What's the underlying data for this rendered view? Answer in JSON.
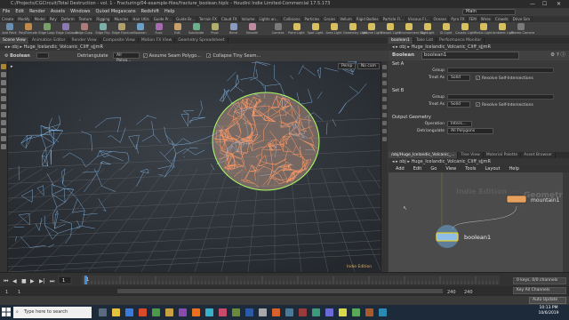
{
  "window": {
    "title": "C:/Projects/CGCircuit/Total Destruction - vol. 1 - Fracturing/04-example-files/fracture_boolean.hiplc - Houdini Indie Limited-Commercial 17.5.173",
    "minimize_glyph": "—",
    "maximize_glyph": "☐",
    "close_glyph": "✕"
  },
  "menubar": {
    "items": [
      "File",
      "Edit",
      "Render",
      "Assets",
      "Windows",
      "Quixel Megascans",
      "Redshift",
      "Help"
    ],
    "desktop": "Main"
  },
  "shelf": {
    "tabs": [
      "Create",
      "Modify",
      "Model",
      "Poly",
      "Deform",
      "Texture",
      "Rigging",
      "Muscles",
      "Hair Utils",
      "Guide Pr...",
      "Guide Br...",
      "Terrain FX",
      "Cloud FX",
      "Volume"
    ],
    "right_tabs": [
      "Lights an...",
      "Collisions",
      "Particles",
      "Grains",
      "Vellum",
      "Rigid Bodies",
      "Particle Fl...",
      "Viscous Fl...",
      "Oceans",
      "Pyro FX",
      "FEM",
      "Wires",
      "Crowds",
      "Drive Sim"
    ],
    "tools": [
      "Add Point",
      "PolyExtrude",
      "Edge Loop",
      "Edge Collapse",
      "Edge Cusp",
      "Edge Flip",
      "Edge Fracture",
      "Boolean",
      "Fuse",
      "Edit",
      "Subdivide",
      "Pivot",
      "Bend",
      "Smooth"
    ],
    "right_tools": [
      "Camera",
      "Point Light",
      "Spot Light",
      "Area Light",
      "Geometry Light",
      "Volume Light",
      "Distant Light",
      "Environment Light",
      "Sky Light",
      "GI Light",
      "Caustic Light",
      "Portal Light",
      "Ambient Light",
      "Stereo Camera"
    ]
  },
  "viewport_pane": {
    "tabs": [
      "Scene View",
      "Animation Editor",
      "Render View",
      "Composite View",
      "Motion FX View",
      "Geometry Spreadsheet"
    ],
    "path": [
      "obj",
      "Huge_Icelandic_Volcanic_Cliff_sjjmR"
    ],
    "node_label": "Boolean",
    "group_field": "",
    "operation_label": "Detriangulate",
    "operation_value": "All Polyg...",
    "toggles": [
      {
        "label": "Assume Seam Polygo...",
        "on": true
      },
      {
        "label": "Collapse Tiny Seam...",
        "on": true
      }
    ],
    "view_label": "Persp",
    "camera_label": "No cam",
    "watermark": "Indie Edition"
  },
  "parameters_pane": {
    "tabs": [
      "boolean1",
      "Take List",
      "Performance Monitor"
    ],
    "path": [
      "obj",
      "Huge_Icelandic_Volcanic_Cliff_sjjmR"
    ],
    "node_type": "Boolean",
    "node_name": "boolean1",
    "set_a": {
      "header": "Set A",
      "group_label": "Group",
      "group_value": "",
      "treat_as_label": "Treat As",
      "treat_as_value": "Solid",
      "resolve_label": "Resolve Self-Intersections",
      "resolve_on": true
    },
    "set_b": {
      "header": "Set B",
      "group_label": "Group",
      "group_value": "",
      "treat_as_label": "Treat As",
      "treat_as_value": "Solid",
      "resolve_label": "Resolve Self-Intersections",
      "resolve_on": true
    },
    "output": {
      "header": "Output Geometry",
      "operation_label": "Operation",
      "operation_value": "Inters...",
      "detriangulate_label": "Detriangulate",
      "detriangulate_value": "All Polygons"
    }
  },
  "network_pane": {
    "tabs": [
      "/obj/Huge_Icelandic_Volcanic_...",
      "Tree View",
      "Material Palette",
      "Asset Browser"
    ],
    "path": [
      "obj",
      "Huge_Icelandic_Volcanic_Cliff_sjjmR"
    ],
    "menu": [
      "Add",
      "Edit",
      "Go",
      "View",
      "Tools",
      "Layout",
      "Help"
    ],
    "watermark_left": "Indie Edition",
    "watermark_right": "Geometry",
    "nodes": [
      {
        "name": "mountain1",
        "color": "#e8a060"
      },
      {
        "name": "boolean1",
        "color": "#8fbfe8"
      }
    ]
  },
  "timeline": {
    "frame": "1",
    "start": "1",
    "start2": "1",
    "end": "240",
    "end2": "240",
    "keys_label": "0 keys, 0/0 channels",
    "all_channels_label": "Key All Channels"
  },
  "statusbar": {
    "auto_update": "Auto Update"
  },
  "taskbar": {
    "search_placeholder": "Type here to search",
    "time": "10:13 PM",
    "date": "10/6/2019"
  },
  "colors": {
    "wire_blue": "#8ec8ff",
    "wire_orange": "#ff9a66",
    "wire_green": "#aaff66",
    "node_selected": "#ffd500"
  }
}
